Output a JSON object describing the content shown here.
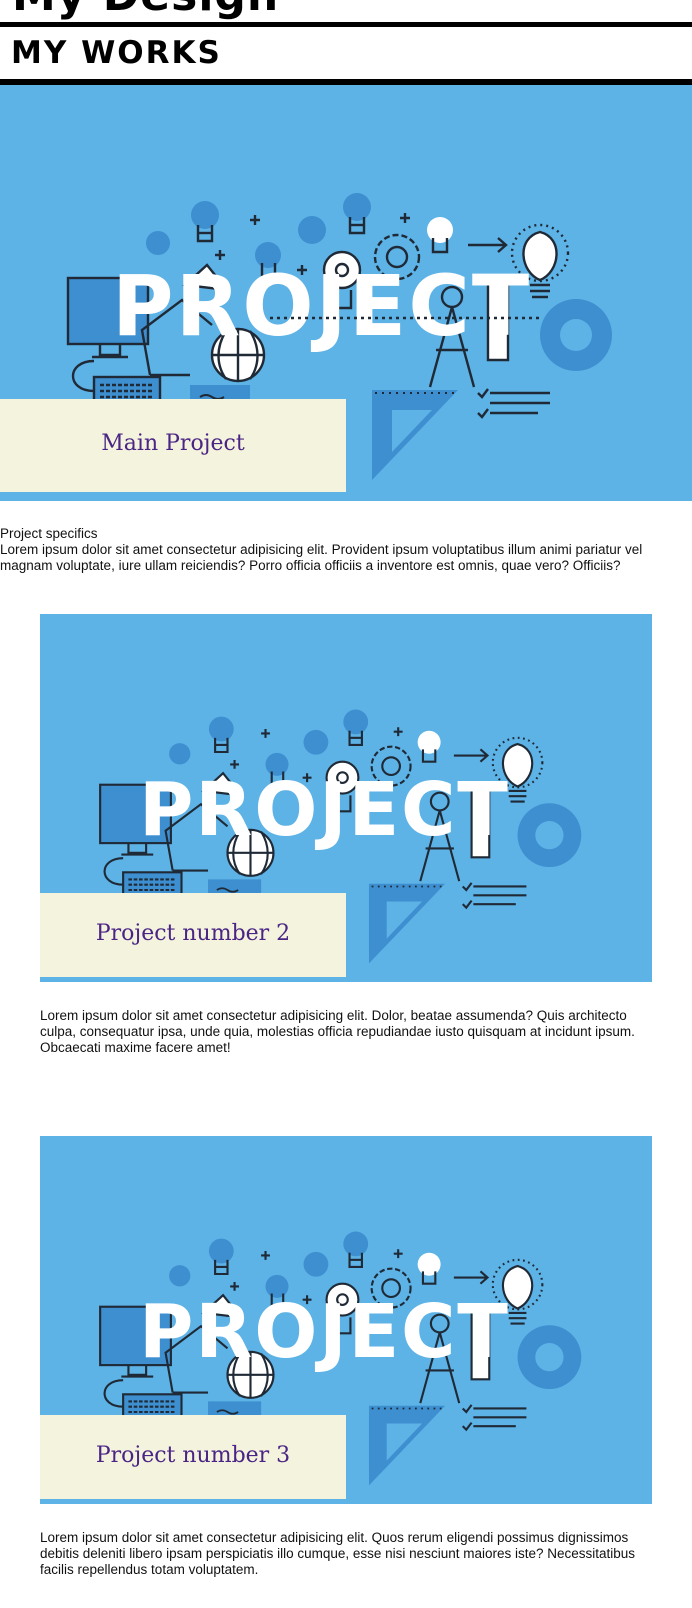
{
  "header": {
    "site_title": "My Design"
  },
  "works_section": {
    "heading": "MY WORKS"
  },
  "image_text": "PROJECT",
  "projects": [
    {
      "caption": "Main Project",
      "specifics_label": "Project specifics",
      "description": "Lorem ipsum dolor sit amet consectetur adipisicing elit. Provident ipsum voluptatibus illum animi pariatur vel magnam voluptate, iure ullam reiciendis? Porro officia officiis a inventore est omnis, quae vero? Officiis?"
    },
    {
      "caption": "Project number 2",
      "description": "Lorem ipsum dolor sit amet consectetur adipisicing elit. Dolor, beatae assumenda? Quis architecto culpa, consequatur ipsa, unde quia, molestias officia repudiandae iusto quisquam at incidunt ipsum. Obcaecati maxime facere amet!"
    },
    {
      "caption": "Project number 3",
      "description": "Lorem ipsum dolor sit amet consectetur adipisicing elit. Quos rerum eligendi possimus dignissimos debitis deleniti libero ipsam perspiciatis illo cumque, esse nisi nesciunt maiores iste? Necessitatibus facilis repellendus totam voluptatem."
    }
  ],
  "colors": {
    "card_background": "#5db2e6",
    "caption_background": "#f4f3dd",
    "caption_text": "#4a2585",
    "icon_dark": "#1f2a36",
    "icon_mid": "#3d8fd0"
  }
}
